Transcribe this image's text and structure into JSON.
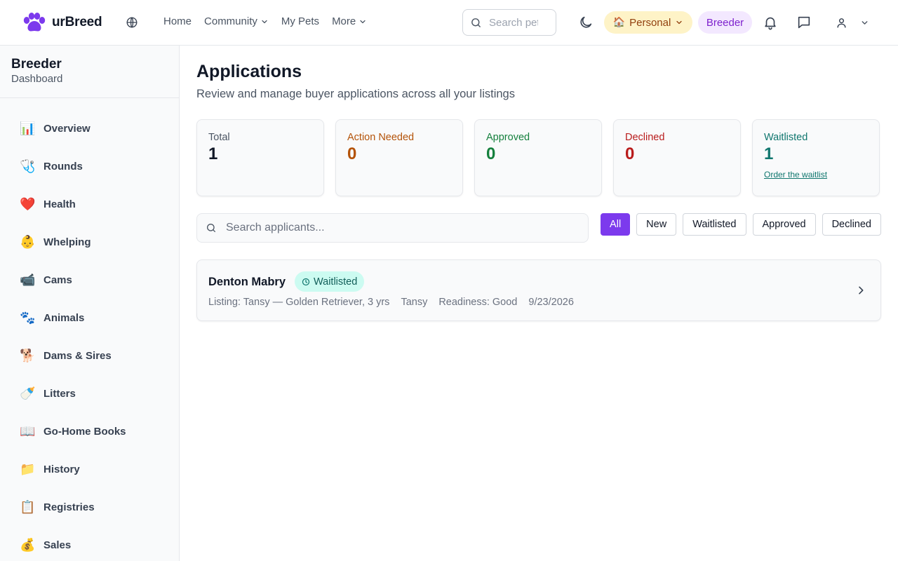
{
  "header": {
    "brand": "urBreed",
    "nav": [
      {
        "label": "Home",
        "has_menu": false
      },
      {
        "label": "Community",
        "has_menu": true
      },
      {
        "label": "My Pets",
        "has_menu": false
      },
      {
        "label": "More",
        "has_menu": true
      }
    ],
    "search_placeholder": "Search pets",
    "personal_label": "Personal",
    "personal_emoji": "🏠",
    "breeder_label": "Breeder",
    "colors": {
      "personal_bg": "#fef3c7",
      "personal_text": "#92400e",
      "breeder_bg": "#f3e8ff",
      "breeder_text": "#7e22ce",
      "brand": "#7c3aed"
    }
  },
  "sidebar": {
    "title": "Breeder",
    "subtitle": "Dashboard",
    "items": [
      {
        "emoji": "📊",
        "label": "Overview"
      },
      {
        "emoji": "🩺",
        "label": "Rounds"
      },
      {
        "emoji": "❤️",
        "label": "Health"
      },
      {
        "emoji": "👶",
        "label": "Whelping"
      },
      {
        "emoji": "📹",
        "label": "Cams"
      },
      {
        "emoji": "🐾",
        "label": "Animals"
      },
      {
        "emoji": "🐕",
        "label": "Dams & Sires"
      },
      {
        "emoji": "🍼",
        "label": "Litters"
      },
      {
        "emoji": "📖",
        "label": "Go-Home Books"
      },
      {
        "emoji": "📁",
        "label": "History"
      },
      {
        "emoji": "📋",
        "label": "Registries"
      },
      {
        "emoji": "💰",
        "label": "Sales"
      }
    ]
  },
  "main": {
    "title": "Applications",
    "subtitle": "Review and manage buyer applications across all your listings",
    "stats": [
      {
        "label": "Total",
        "value": "1",
        "label_color": "#4b5563",
        "value_color": "#111827",
        "link": ""
      },
      {
        "label": "Action Needed",
        "value": "0",
        "label_color": "#b45309",
        "value_color": "#b45309",
        "link": ""
      },
      {
        "label": "Approved",
        "value": "0",
        "label_color": "#15803d",
        "value_color": "#15803d",
        "link": ""
      },
      {
        "label": "Declined",
        "value": "0",
        "label_color": "#b91c1c",
        "value_color": "#b91c1c",
        "link": ""
      },
      {
        "label": "Waitlisted",
        "value": "1",
        "label_color": "#0f766e",
        "value_color": "#0f766e",
        "link": "Order the waitlist"
      }
    ],
    "search_placeholder": "Search applicants...",
    "filters": [
      {
        "label": "All",
        "active": true
      },
      {
        "label": "New",
        "active": false
      },
      {
        "label": "Waitlisted",
        "active": false
      },
      {
        "label": "Approved",
        "active": false
      },
      {
        "label": "Declined",
        "active": false
      }
    ],
    "applications": [
      {
        "name": "Denton Mabry",
        "status": "Waitlisted",
        "listing": "Listing: Tansy — Golden Retriever, 3 yrs",
        "pet": "Tansy",
        "readiness": "Readiness: Good",
        "date": "9/23/2026"
      }
    ]
  }
}
